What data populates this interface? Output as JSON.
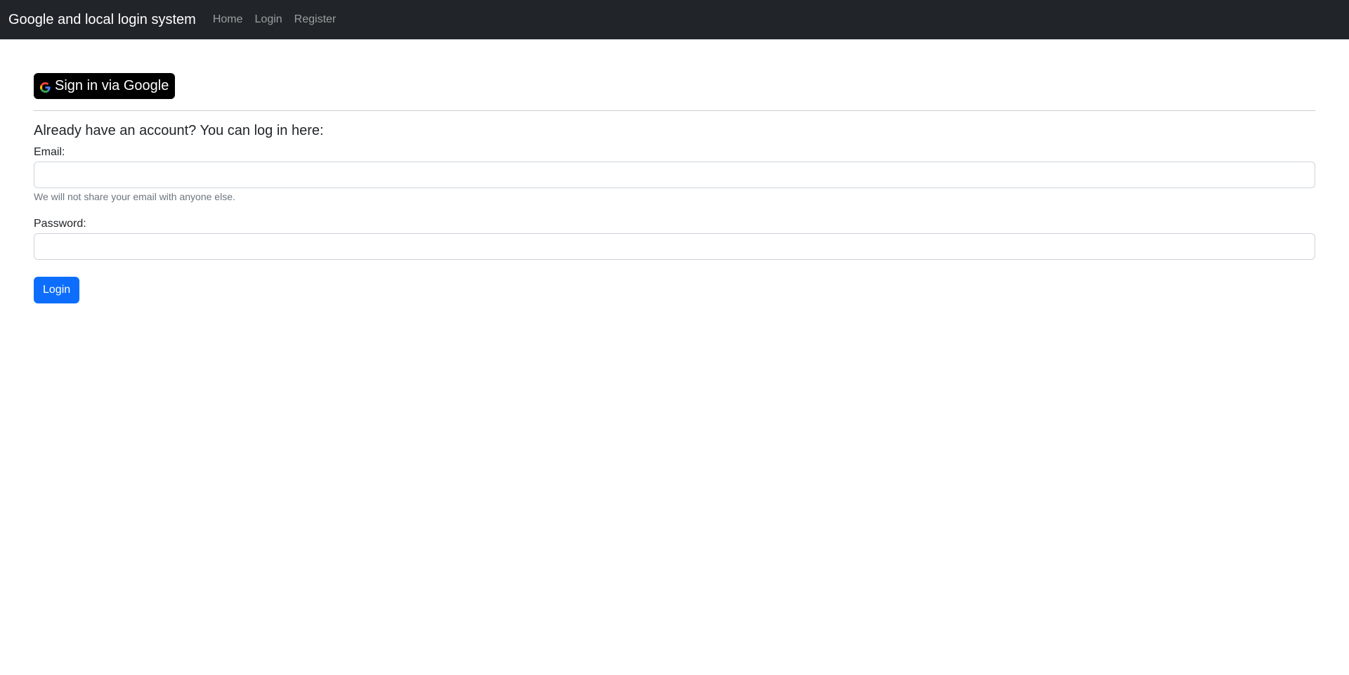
{
  "navbar": {
    "brand": "Google and local login system",
    "links": [
      {
        "label": "Home"
      },
      {
        "label": "Login"
      },
      {
        "label": "Register"
      }
    ]
  },
  "google_signin": {
    "label": "Sign in via Google",
    "icon": "google-icon"
  },
  "login_form": {
    "lead": "Already have an account? You can log in here:",
    "email": {
      "label": "Email:",
      "value": "",
      "help": "We will not share your email with anyone else."
    },
    "password": {
      "label": "Password:",
      "value": ""
    },
    "submit_label": "Login"
  },
  "colors": {
    "navbar_bg": "#212529",
    "primary": "#0d6efd",
    "google_button_bg": "#000000"
  }
}
